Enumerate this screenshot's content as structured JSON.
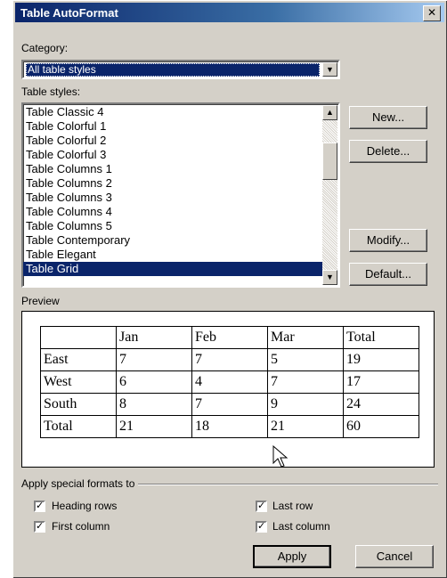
{
  "window": {
    "title": "Table AutoFormat",
    "close_glyph": "✕"
  },
  "category": {
    "label": "Category:",
    "value": "All table styles"
  },
  "table_styles": {
    "label": "Table styles:",
    "items": [
      "Table Classic 4",
      "Table Colorful 1",
      "Table Colorful 2",
      "Table Colorful 3",
      "Table Columns 1",
      "Table Columns 2",
      "Table Columns 3",
      "Table Columns 4",
      "Table Columns 5",
      "Table Contemporary",
      "Table Elegant",
      "Table Grid"
    ],
    "selected": "Table Grid"
  },
  "buttons": {
    "new": "New...",
    "delete": "Delete...",
    "modify": "Modify...",
    "default": "Default...",
    "apply": "Apply",
    "cancel": "Cancel"
  },
  "preview": {
    "label": "Preview",
    "rows": [
      [
        "",
        "Jan",
        "Feb",
        "Mar",
        "Total"
      ],
      [
        "East",
        "7",
        "7",
        "5",
        "19"
      ],
      [
        "West",
        "6",
        "4",
        "7",
        "17"
      ],
      [
        "South",
        "8",
        "7",
        "9",
        "24"
      ],
      [
        "Total",
        "21",
        "18",
        "21",
        "60"
      ]
    ]
  },
  "special_formats": {
    "label": "Apply special formats to",
    "heading_rows": {
      "label": "Heading rows",
      "checked": true
    },
    "first_column": {
      "label": "First column",
      "checked": true
    },
    "last_row": {
      "label": "Last row",
      "checked": true
    },
    "last_column": {
      "label": "Last column",
      "checked": true
    }
  },
  "colors": {
    "title_bar": "#0a246a",
    "face": "#d4d0c8",
    "selection": "#0a246a"
  }
}
